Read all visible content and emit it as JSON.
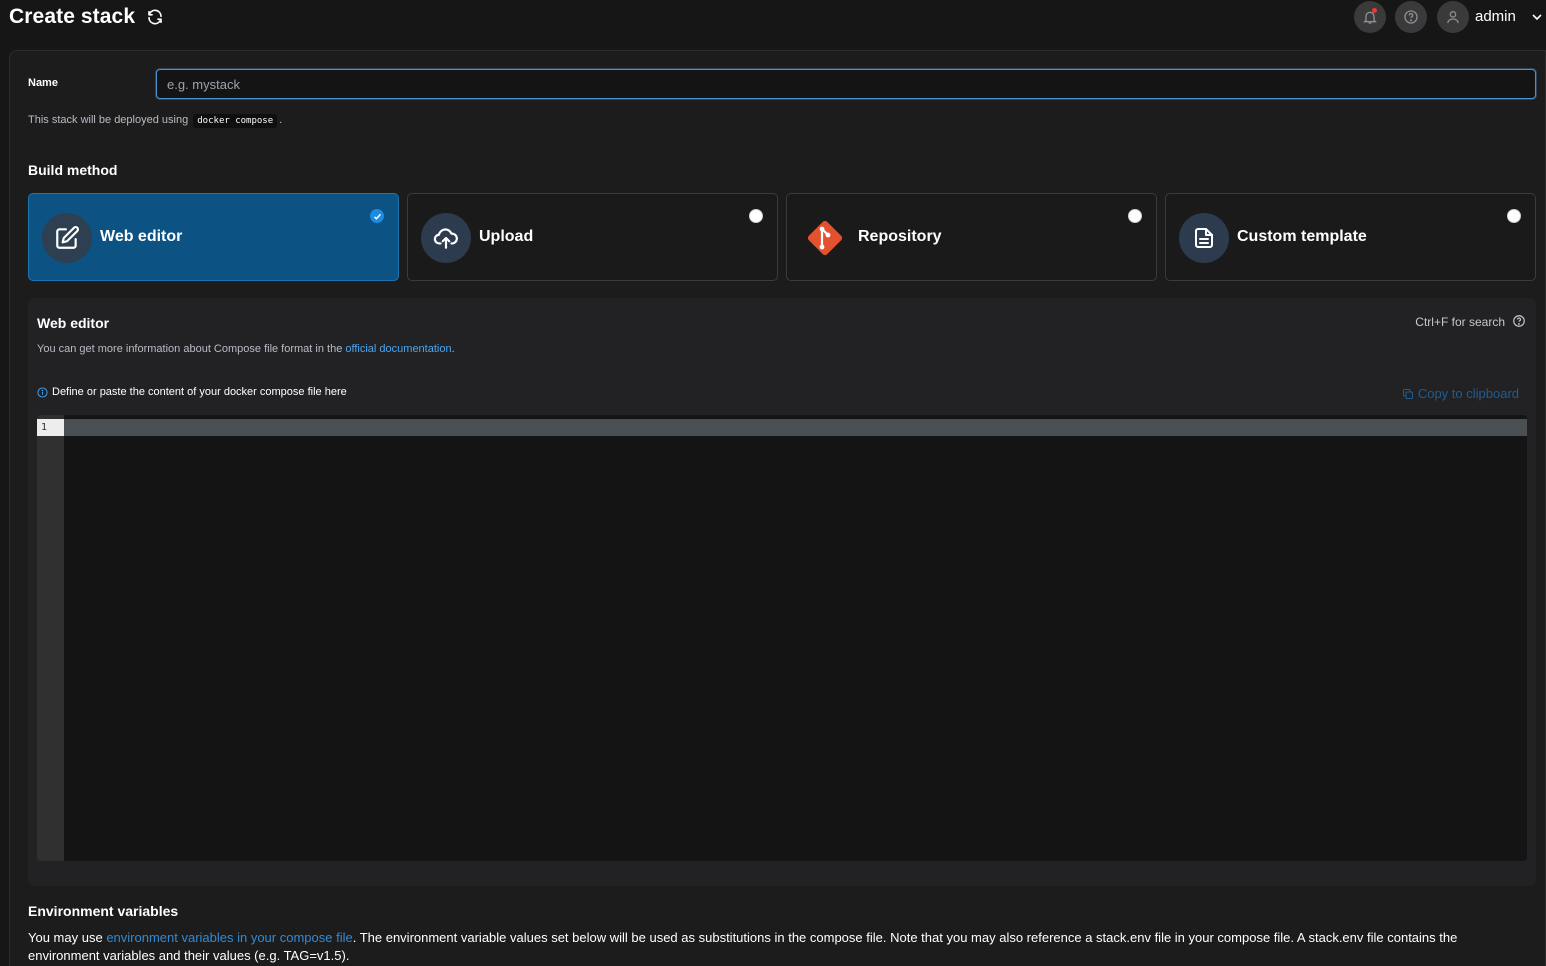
{
  "header": {
    "title": "Create stack",
    "user": "admin"
  },
  "form": {
    "name_label": "Name",
    "name_placeholder": "e.g. mystack",
    "name_value": "",
    "deploy_note_prefix": "This stack will be deployed using",
    "deploy_tool": "docker compose",
    "deploy_note_suffix": "."
  },
  "build_method": {
    "title": "Build method",
    "options": [
      {
        "label": "Web editor",
        "icon": "edit-icon",
        "selected": true
      },
      {
        "label": "Upload",
        "icon": "cloud-upload-icon",
        "selected": false
      },
      {
        "label": "Repository",
        "icon": "git-icon",
        "selected": false
      },
      {
        "label": "Custom template",
        "icon": "file-text-icon",
        "selected": false
      }
    ]
  },
  "editor": {
    "title": "Web editor",
    "desc_prefix": "You can get more information about Compose file format in the",
    "desc_link": "official documentation",
    "desc_suffix": ".",
    "search_hint": "Ctrl+F for search",
    "define_hint": "Define or paste the content of your docker compose file here",
    "copy_label": "Copy to clipboard",
    "line_numbers": [
      "1"
    ]
  },
  "env": {
    "title": "Environment variables",
    "desc_prefix": "You may use",
    "desc_link": "environment variables in your compose file",
    "desc_suffix": ". The environment variable values set below will be used as substitutions in the compose file. Note that you may also reference a stack.env file in your compose file. A stack.env file contains the environment variables and their values (e.g. TAG=v1.5)."
  },
  "colors": {
    "accent": "#1d8be0",
    "selected_card": "#0c5283",
    "link": "#4aa5f0",
    "git_orange": "#e4512f"
  }
}
